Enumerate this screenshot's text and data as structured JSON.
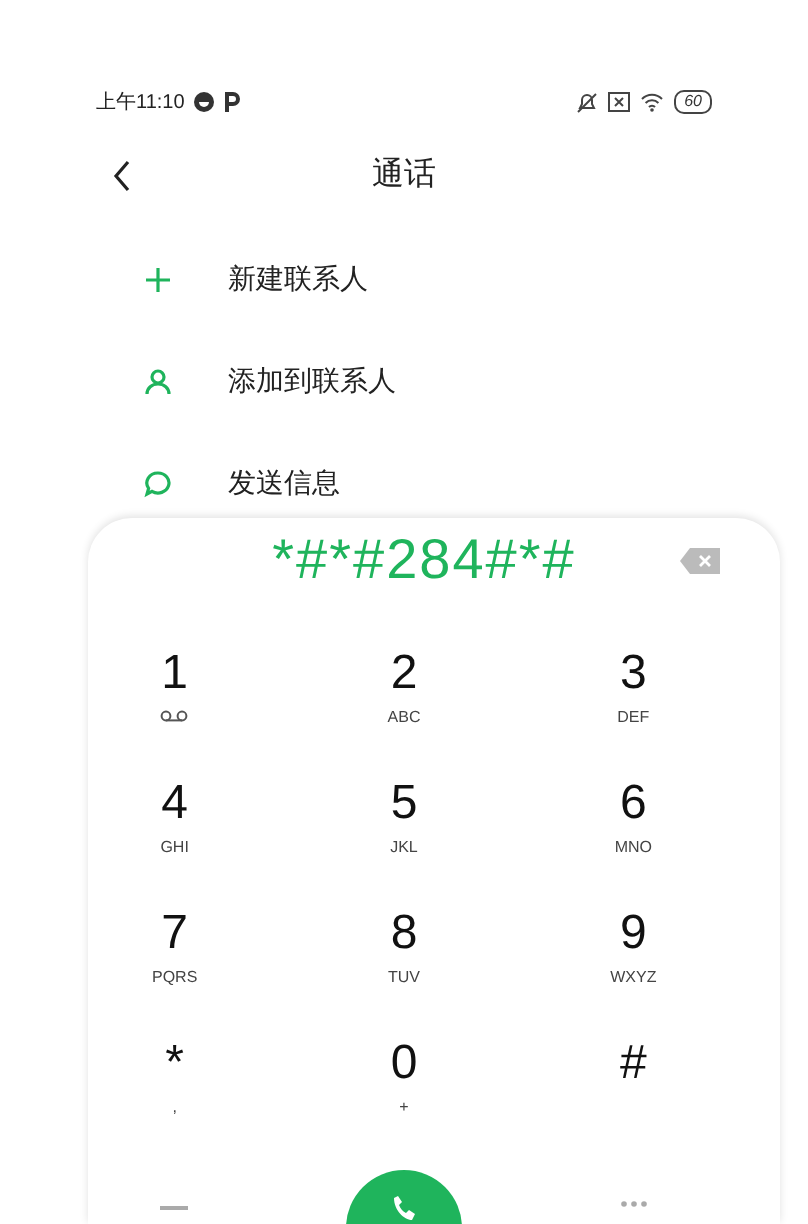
{
  "status_bar": {
    "time": "上午11:10",
    "battery": "60"
  },
  "header": {
    "title": "通话"
  },
  "actions": [
    {
      "kind": "add",
      "label": "新建联系人"
    },
    {
      "kind": "person",
      "label": "添加到联系人"
    },
    {
      "kind": "message",
      "label": "发送信息"
    }
  ],
  "dialer": {
    "number": "*#*#284#*#",
    "keys": [
      {
        "digit": "1",
        "kind": "voicemail"
      },
      {
        "digit": "2",
        "letters": "ABC"
      },
      {
        "digit": "3",
        "letters": "DEF"
      },
      {
        "digit": "4",
        "letters": "GHI"
      },
      {
        "digit": "5",
        "letters": "JKL"
      },
      {
        "digit": "6",
        "letters": "MNO"
      },
      {
        "digit": "7",
        "letters": "PQRS"
      },
      {
        "digit": "8",
        "letters": "TUV"
      },
      {
        "digit": "9",
        "letters": "WXYZ"
      },
      {
        "digit": "*",
        "letters": ","
      },
      {
        "digit": "0",
        "letters": "+"
      },
      {
        "digit": "#"
      }
    ]
  }
}
